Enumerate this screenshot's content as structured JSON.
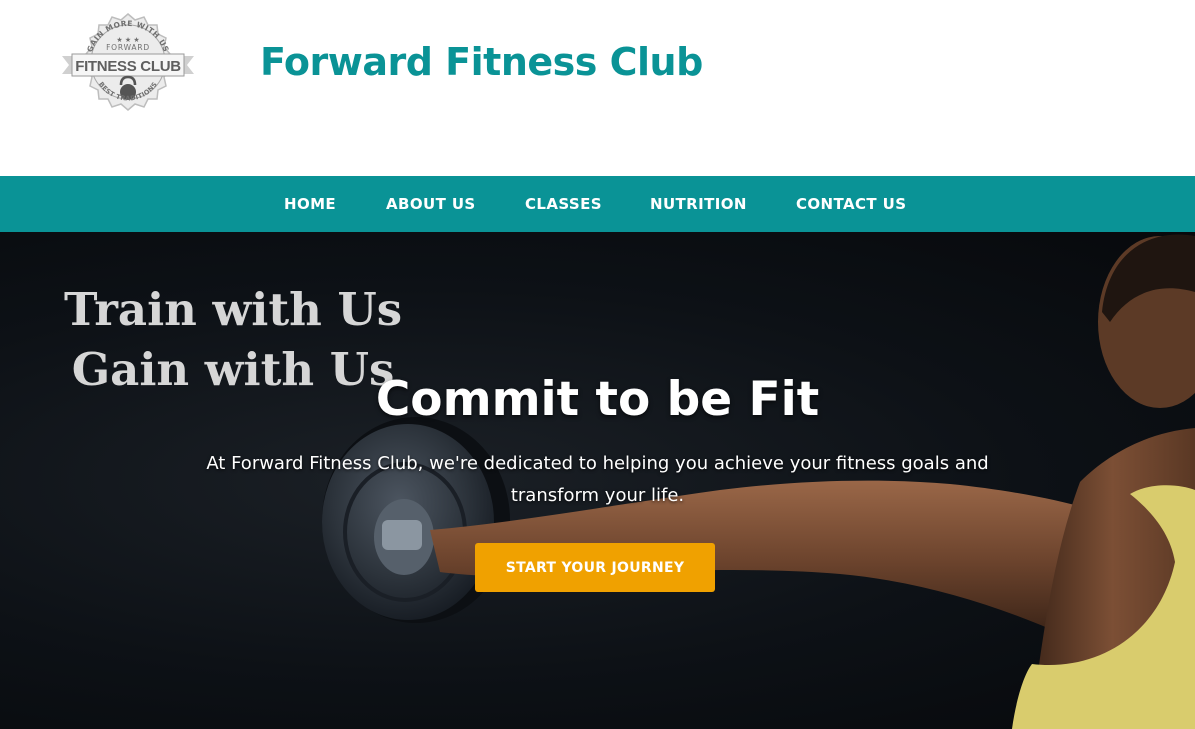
{
  "brand": {
    "site_title": "Forward Fitness Club",
    "logo": {
      "top_text": "GAIN MORE WITH US",
      "sub_text": "FORWARD",
      "banner_text": "FITNESS CLUB",
      "bottom_text": "BEST TRADITIONS",
      "icon": "kettlebell-icon"
    }
  },
  "nav": {
    "items": [
      {
        "label": "HOME"
      },
      {
        "label": "ABOUT US"
      },
      {
        "label": "CLASSES"
      },
      {
        "label": "NUTRITION"
      },
      {
        "label": "CONTACT US"
      }
    ]
  },
  "hero": {
    "tagline_line1": "Train with Us",
    "tagline_line2": "Gain with Us",
    "heading": "Commit to be Fit",
    "description": "At Forward Fitness Club, we're dedicated to helping you achieve your fitness goals and transform your life.",
    "cta_label": "START YOUR JOURNEY",
    "image": "athlete-lifting-dumbbell-photo"
  },
  "colors": {
    "brand_teal": "#0a9396",
    "cta_orange": "#f0a100",
    "hero_bg": "#0d1116",
    "tagline_gray": "#d6d6d6"
  }
}
